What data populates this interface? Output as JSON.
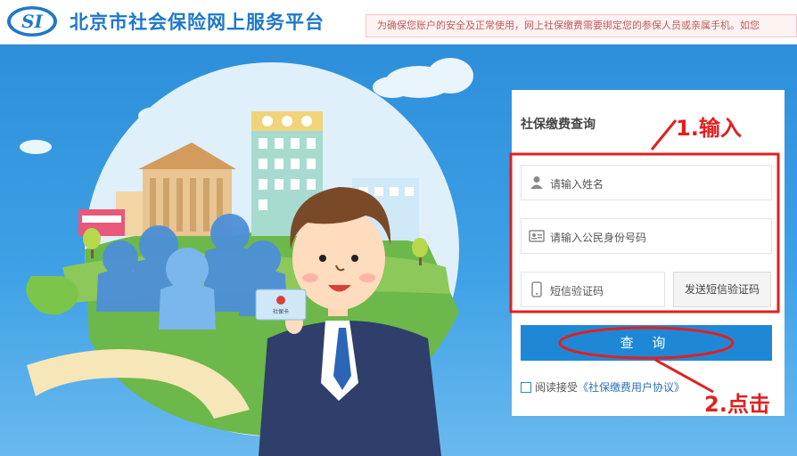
{
  "header": {
    "logo_text": "SI",
    "title": "北京市社会保险网上服务平台",
    "notice": "为确保您账户的安全及正常使用，网上社保缴费需要绑定您的参保人员或亲属手机。如您"
  },
  "illustration": {
    "card_text": "社保卡"
  },
  "form": {
    "title": "社保缴费查询",
    "name_placeholder": "请输入姓名",
    "id_placeholder": "请输入公民身份号码",
    "sms_placeholder": "短信验证码",
    "send_sms_label": "发送短信验证码",
    "query_label": "查 询",
    "agree_prefix": "阅读接受",
    "agreement_link": "《社保缴费用户协议》"
  },
  "annotations": {
    "step1": "1.输入",
    "step2": "2.点击"
  },
  "colors": {
    "brand_blue": "#1e78c8",
    "button_blue": "#1f88d6",
    "annotation_red": "#e02020",
    "background_blue": "#3ea1e6"
  }
}
